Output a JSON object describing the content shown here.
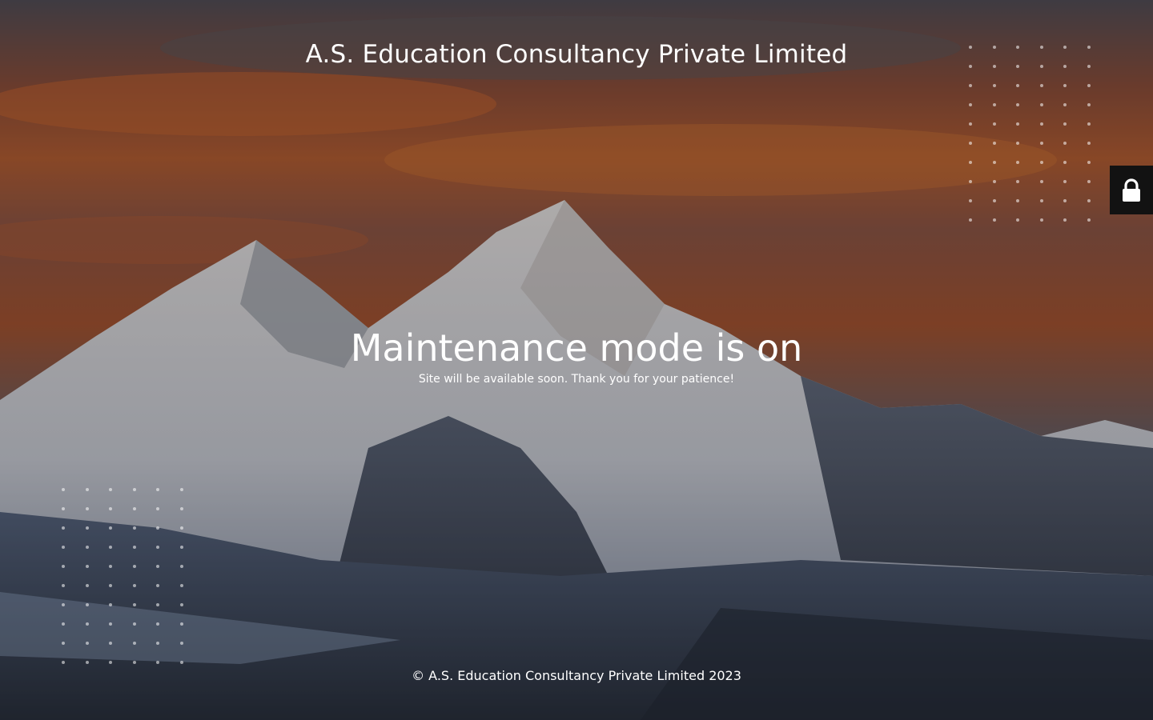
{
  "site": {
    "title": "A.S. Education Consultancy Private Limited"
  },
  "main": {
    "heading": "Maintenance mode is on",
    "message": "Site will be available soon. Thank you for your patience!"
  },
  "footer": {
    "copyright": "© A.S. Education Consultancy Private Limited 2023"
  },
  "login": {
    "icon": "lock-icon"
  },
  "colors": {
    "text": "#ffffff",
    "login_tab_bg": "#121212"
  }
}
